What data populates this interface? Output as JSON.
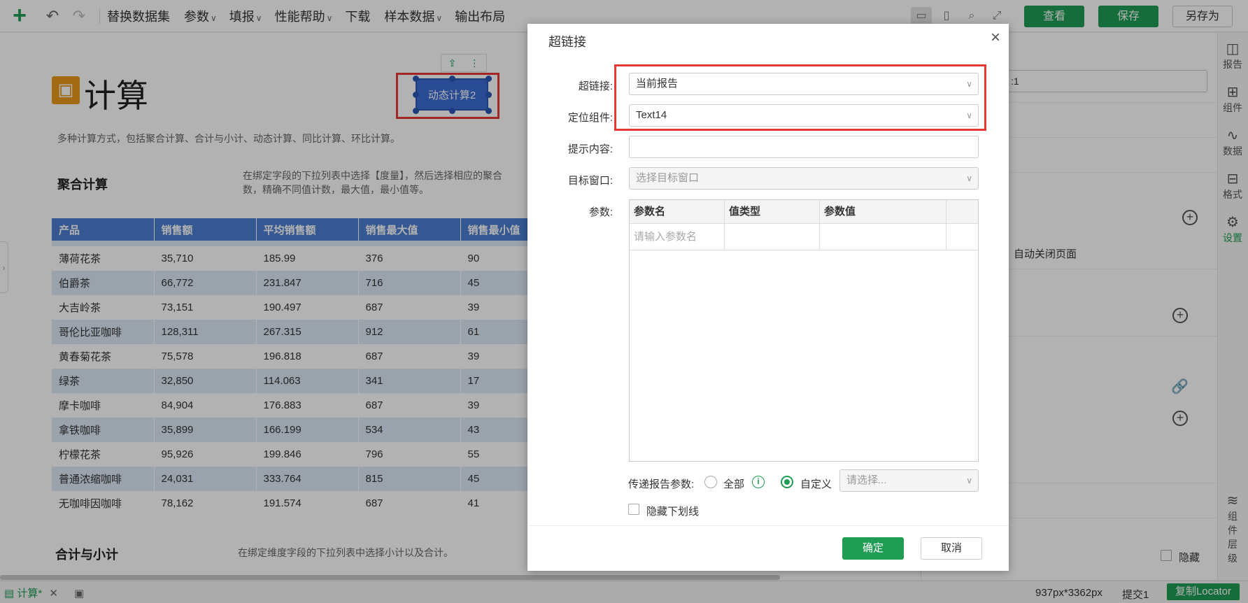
{
  "toolbar": {
    "add_icon": "plus-icon",
    "menus": [
      {
        "label": "替换数据集",
        "caret": ""
      },
      {
        "label": "参数",
        "caret": "∨"
      },
      {
        "label": "填报",
        "caret": "∨"
      },
      {
        "label": "性能帮助",
        "caret": "∨"
      },
      {
        "label": "下载",
        "caret": ""
      },
      {
        "label": "样本数据",
        "caret": "∨"
      },
      {
        "label": "输出布局",
        "caret": ""
      }
    ],
    "view_label": "查看",
    "save_label": "保存",
    "save_as_label": "另存为",
    "accent_color": "#1f9d55"
  },
  "report": {
    "title": "计算",
    "description": "多种计算方式，包括聚合计算、合计与小计、动态计算、同比计算、环比计算。",
    "selected_button_label": "动态计算2",
    "section1": {
      "title": "聚合计算",
      "desc_line1": "在绑定字段的下拉列表中选择【度量】，然后选择相应的聚合",
      "desc_line2": "数，精确不同值计数，最大值，最小值等。"
    },
    "section2": {
      "title": "合计与小计",
      "desc": "在绑定维度字段的下拉列表中选择小计以及合计。"
    },
    "table": {
      "headers": [
        "产品",
        "销售额",
        "平均销售额",
        "销售最大值",
        "销售最小值"
      ],
      "rows": [
        [
          "薄荷花茶",
          "35,710",
          "185.99",
          "376",
          "90"
        ],
        [
          "伯爵茶",
          "66,772",
          "231.847",
          "716",
          "45"
        ],
        [
          "大吉岭茶",
          "73,151",
          "190.497",
          "687",
          "39"
        ],
        [
          "哥伦比亚咖啡",
          "128,311",
          "267.315",
          "912",
          "61"
        ],
        [
          "黄春菊花茶",
          "75,578",
          "196.818",
          "687",
          "39"
        ],
        [
          "绿茶",
          "32,850",
          "114.063",
          "341",
          "17"
        ],
        [
          "摩卡咖啡",
          "84,904",
          "176.883",
          "687",
          "39"
        ],
        [
          "拿铁咖啡",
          "35,899",
          "166.199",
          "534",
          "43"
        ],
        [
          "柠檬花茶",
          "95,926",
          "199.846",
          "796",
          "55"
        ],
        [
          "普通浓缩咖啡",
          "24,031",
          "333.764",
          "815",
          "45"
        ],
        [
          "无咖啡因咖啡",
          "78,162",
          "191.574",
          "687",
          "41"
        ]
      ]
    }
  },
  "right_panel": {
    "field_value": ":1",
    "auto_close_label": "自动关闭页面",
    "hide_label": "隐藏"
  },
  "sidebar": {
    "items": [
      {
        "label": "报告",
        "icon": "chart-icon"
      },
      {
        "label": "组件",
        "icon": "component-icon"
      },
      {
        "label": "数据",
        "icon": "data-icon"
      },
      {
        "label": "格式",
        "icon": "grid-icon"
      },
      {
        "label": "设置",
        "icon": "gear-icon"
      }
    ],
    "layers_label": "组件层级"
  },
  "bottombar": {
    "tab_label": "计算*",
    "size_text": "937px*3362px",
    "submit_text": "提交1",
    "locator_label": "复制Locator"
  },
  "dialog": {
    "title": "超链接",
    "hyperlink_label": "超链接:",
    "hyperlink_value": "当前报告",
    "locate_label": "定位组件:",
    "locate_value": "Text14",
    "tooltip_label": "提示内容:",
    "tooltip_value": "",
    "target_label": "目标窗口:",
    "target_placeholder": "选择目标窗口",
    "params_label": "参数:",
    "param_headers": [
      "参数名",
      "值类型",
      "参数值"
    ],
    "param_name_placeholder": "请输入参数名",
    "pass_params_label": "传递报告参数:",
    "radio_all": "全部",
    "radio_custom": "自定义",
    "select_placeholder": "请选择...",
    "hide_underline_label": "隐藏下划线",
    "ok_label": "确定",
    "cancel_label": "取消"
  }
}
